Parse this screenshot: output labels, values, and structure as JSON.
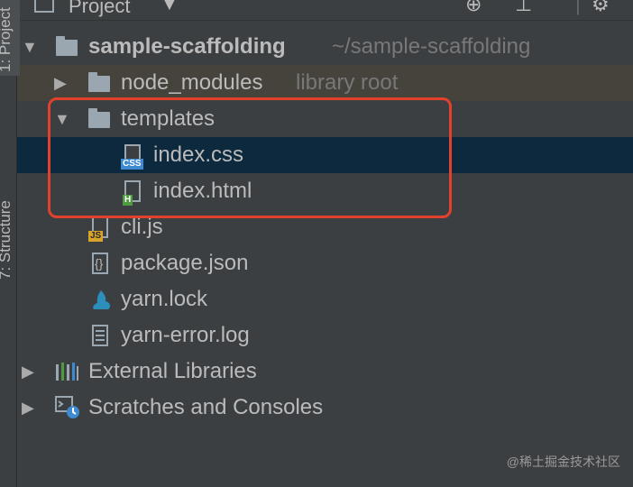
{
  "header": {
    "title": "Project",
    "caret": "▼",
    "icons": [
      "target-icon",
      "collapse-icon",
      "settings-icon"
    ]
  },
  "side_tabs": {
    "project": "1: Project",
    "structure": "7: Structure"
  },
  "tree": {
    "root": {
      "name": "sample-scaffolding",
      "path": "~/sample-scaffolding"
    },
    "node_modules": {
      "name": "node_modules",
      "hint": "library root"
    },
    "templates": {
      "name": "templates"
    },
    "index_css": {
      "name": "index.css",
      "badge": "CSS"
    },
    "index_html": {
      "name": "index.html",
      "badge": "H"
    },
    "cli_js": {
      "name": "cli.js",
      "badge": "JS"
    },
    "package_json": {
      "name": "package.json"
    },
    "yarn_lock": {
      "name": "yarn.lock"
    },
    "yarn_error": {
      "name": "yarn-error.log"
    },
    "external_libraries": {
      "name": "External Libraries"
    },
    "scratches": {
      "name": "Scratches and Consoles"
    }
  },
  "colors": {
    "background": "#3c3f41",
    "selection": "#0d293e",
    "highlight_box": "#e2412d",
    "css_badge": "#3d8ad1",
    "html_badge": "#4f9b3f",
    "js_badge": "#d6a32b"
  },
  "watermark": "@稀土掘金技术社区"
}
